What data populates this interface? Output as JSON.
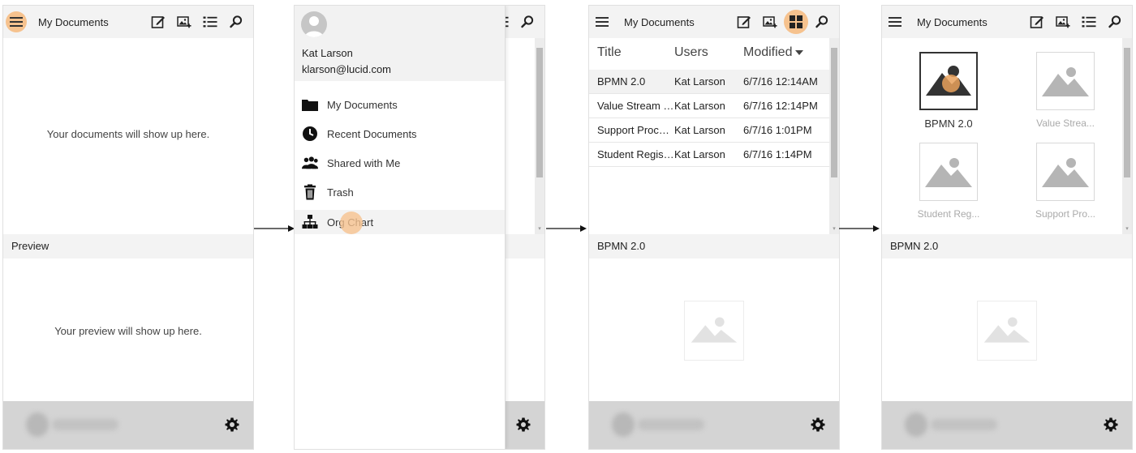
{
  "screen1": {
    "header": {
      "title": "My Documents"
    },
    "empty_message": "Your documents will show up here.",
    "preview": {
      "label": "Preview",
      "empty_message": "Your preview will show up here."
    }
  },
  "screen2": {
    "user": {
      "name": "Kat Larson",
      "email": "klarson@lucid.com"
    },
    "nav": [
      {
        "label": "My Documents",
        "icon": "folder-icon"
      },
      {
        "label": "Recent Documents",
        "icon": "clock-icon"
      },
      {
        "label": "Shared with Me",
        "icon": "people-icon"
      },
      {
        "label": "Trash",
        "icon": "trash-icon"
      },
      {
        "label": "Org Chart",
        "icon": "org-chart-icon",
        "highlighted": true
      }
    ]
  },
  "screen3": {
    "header": {
      "title": "My Documents"
    },
    "table": {
      "columns": [
        "Title",
        "Users",
        "Modified"
      ],
      "sort_column": "Modified",
      "rows": [
        {
          "title": "BPMN 2.0",
          "users": "Kat Larson",
          "modified": "6/7/16 12:14AM",
          "selected": true
        },
        {
          "title": "Value Stream Map",
          "users": "Kat Larson",
          "modified": "6/7/16 12:14PM"
        },
        {
          "title": "Support Process",
          "users": "Kat Larson",
          "modified": "6/7/16 1:01PM"
        },
        {
          "title": "Student Registration",
          "users": "Kat Larson",
          "modified": "6/7/16 1:14PM"
        }
      ]
    },
    "preview": {
      "label": "BPMN 2.0"
    }
  },
  "screen4": {
    "header": {
      "title": "My Documents"
    },
    "tiles": [
      {
        "label": "BPMN 2.0",
        "selected": true
      },
      {
        "label": "Value Strea..."
      },
      {
        "label": "Student Reg..."
      },
      {
        "label": "Support Pro..."
      }
    ],
    "preview": {
      "label": "BPMN 2.0"
    }
  },
  "colors": {
    "highlight": "#f6c28e",
    "header_bg": "#f3f3f3",
    "footer_bg": "#d4d4d4"
  }
}
